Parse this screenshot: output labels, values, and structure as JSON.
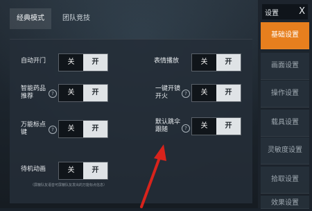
{
  "tabs": [
    "经典模式",
    "团队竞技"
  ],
  "left_settings": [
    {
      "label": "自动开门",
      "off": "关",
      "on": "开",
      "help": false
    },
    {
      "label": "智能药品推荐",
      "off": "关",
      "on": "开",
      "help": true
    },
    {
      "label": "万能标点键",
      "off": "关",
      "on": "开",
      "help": true
    },
    {
      "label": "待机动画",
      "off": "关",
      "on": "开",
      "help": false
    }
  ],
  "right_settings": [
    {
      "label": "表情播放",
      "off": "关",
      "on": "开",
      "help": false
    },
    {
      "label": "一键开镜开火",
      "off": "关",
      "on": "开",
      "help": true
    },
    {
      "label": "默认跳伞跟随",
      "off": "关",
      "on": "开",
      "help": true
    }
  ],
  "note": "（屏蔽队友语音可屏蔽队友发出的万能标点信息）",
  "sidebar": {
    "title": "设置",
    "close": "X",
    "items": [
      "基础设置",
      "画面设置",
      "操作设置",
      "载具设置",
      "灵敏度设置",
      "拾取设置",
      "效果设置"
    ]
  },
  "colors": {
    "accent": "#e77f1e",
    "arrow": "#d8231c"
  }
}
